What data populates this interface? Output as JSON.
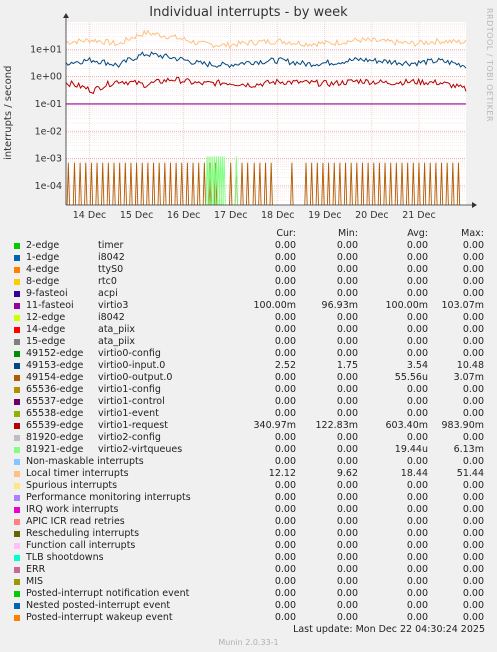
{
  "title": "Individual interrupts - by week",
  "side_label": "RRDTOOL / TOBI OETIKER",
  "ylabel": "interrupts / second",
  "legend_header": {
    "cur": "Cur:",
    "min": "Min:",
    "avg": "Avg:",
    "max": "Max:"
  },
  "legend": [
    {
      "a": "2-edge",
      "b": "timer",
      "color": "#00cc00",
      "cur": "0.00",
      "min": "0.00",
      "avg": "0.00",
      "max": "0.00"
    },
    {
      "a": "1-edge",
      "b": "i8042",
      "color": "#0066b3",
      "cur": "0.00",
      "min": "0.00",
      "avg": "0.00",
      "max": "0.00"
    },
    {
      "a": "4-edge",
      "b": "ttyS0",
      "color": "#ff8000",
      "cur": "0.00",
      "min": "0.00",
      "avg": "0.00",
      "max": "0.00"
    },
    {
      "a": "8-edge",
      "b": "rtc0",
      "color": "#ffcc00",
      "cur": "0.00",
      "min": "0.00",
      "avg": "0.00",
      "max": "0.00"
    },
    {
      "a": "9-fasteoi",
      "b": "acpi",
      "color": "#330099",
      "cur": "0.00",
      "min": "0.00",
      "avg": "0.00",
      "max": "0.00"
    },
    {
      "a": "11-fasteoi",
      "b": "virtio3",
      "color": "#990099",
      "cur": "100.00m",
      "min": "96.93m",
      "avg": "100.00m",
      "max": "103.07m"
    },
    {
      "a": "12-edge",
      "b": "i8042",
      "color": "#ccff00",
      "cur": "0.00",
      "min": "0.00",
      "avg": "0.00",
      "max": "0.00"
    },
    {
      "a": "14-edge",
      "b": "ata_piix",
      "color": "#ff0000",
      "cur": "0.00",
      "min": "0.00",
      "avg": "0.00",
      "max": "0.00"
    },
    {
      "a": "15-edge",
      "b": "ata_piix",
      "color": "#808080",
      "cur": "0.00",
      "min": "0.00",
      "avg": "0.00",
      "max": "0.00"
    },
    {
      "a": "49152-edge",
      "b": "virtio0-config",
      "color": "#008f00",
      "cur": "0.00",
      "min": "0.00",
      "avg": "0.00",
      "max": "0.00"
    },
    {
      "a": "49153-edge",
      "b": "virtio0-input.0",
      "color": "#00487d",
      "cur": "2.52",
      "min": "1.75",
      "avg": "3.54",
      "max": "10.48"
    },
    {
      "a": "49154-edge",
      "b": "virtio0-output.0",
      "color": "#b35a00",
      "cur": "0.00",
      "min": "0.00",
      "avg": "55.56u",
      "max": "3.07m"
    },
    {
      "a": "65536-edge",
      "b": "virtio1-config",
      "color": "#b38f00",
      "cur": "0.00",
      "min": "0.00",
      "avg": "0.00",
      "max": "0.00"
    },
    {
      "a": "65537-edge",
      "b": "virtio1-control",
      "color": "#6b006b",
      "cur": "0.00",
      "min": "0.00",
      "avg": "0.00",
      "max": "0.00"
    },
    {
      "a": "65538-edge",
      "b": "virtio1-event",
      "color": "#8fb300",
      "cur": "0.00",
      "min": "0.00",
      "avg": "0.00",
      "max": "0.00"
    },
    {
      "a": "65539-edge",
      "b": "virtio1-request",
      "color": "#b30000",
      "cur": "340.97m",
      "min": "122.83m",
      "avg": "603.40m",
      "max": "983.90m"
    },
    {
      "a": "81920-edge",
      "b": "virtio2-config",
      "color": "#bebebe",
      "cur": "0.00",
      "min": "0.00",
      "avg": "0.00",
      "max": "0.00"
    },
    {
      "a": "81921-edge",
      "b": "virtio2-virtqueues",
      "color": "#80ff80",
      "cur": "0.00",
      "min": "0.00",
      "avg": "19.44u",
      "max": "6.13m"
    },
    {
      "a": "Non-maskable interrupts",
      "b": "",
      "color": "#80c9ff",
      "cur": "0.00",
      "min": "0.00",
      "avg": "0.00",
      "max": "0.00"
    },
    {
      "a": "Local timer interrupts",
      "b": "",
      "color": "#ffc080",
      "cur": "12.12",
      "min": "9.62",
      "avg": "18.44",
      "max": "51.44"
    },
    {
      "a": "Spurious interrupts",
      "b": "",
      "color": "#ffe680",
      "cur": "0.00",
      "min": "0.00",
      "avg": "0.00",
      "max": "0.00"
    },
    {
      "a": "Performance monitoring interrupts",
      "b": "",
      "color": "#aa80ff",
      "cur": "0.00",
      "min": "0.00",
      "avg": "0.00",
      "max": "0.00"
    },
    {
      "a": "IRQ work interrupts",
      "b": "",
      "color": "#ee00cc",
      "cur": "0.00",
      "min": "0.00",
      "avg": "0.00",
      "max": "0.00"
    },
    {
      "a": "APIC ICR read retries",
      "b": "",
      "color": "#ff8080",
      "cur": "0.00",
      "min": "0.00",
      "avg": "0.00",
      "max": "0.00"
    },
    {
      "a": "Rescheduling interrupts",
      "b": "",
      "color": "#666600",
      "cur": "0.00",
      "min": "0.00",
      "avg": "0.00",
      "max": "0.00"
    },
    {
      "a": "Function call interrupts",
      "b": "",
      "color": "#ffbfff",
      "cur": "0.00",
      "min": "0.00",
      "avg": "0.00",
      "max": "0.00"
    },
    {
      "a": "TLB shootdowns",
      "b": "",
      "color": "#00ffcc",
      "cur": "0.00",
      "min": "0.00",
      "avg": "0.00",
      "max": "0.00"
    },
    {
      "a": "ERR",
      "b": "",
      "color": "#cc6699",
      "cur": "0.00",
      "min": "0.00",
      "avg": "0.00",
      "max": "0.00"
    },
    {
      "a": "MIS",
      "b": "",
      "color": "#999900",
      "cur": "0.00",
      "min": "0.00",
      "avg": "0.00",
      "max": "0.00"
    },
    {
      "a": "Posted-interrupt notification event",
      "b": "",
      "color": "#00cc00",
      "cur": "0.00",
      "min": "0.00",
      "avg": "0.00",
      "max": "0.00"
    },
    {
      "a": "Nested posted-interrupt event",
      "b": "",
      "color": "#0066b3",
      "cur": "0.00",
      "min": "0.00",
      "avg": "0.00",
      "max": "0.00"
    },
    {
      "a": "Posted-interrupt wakeup event",
      "b": "",
      "color": "#ff8000",
      "cur": "0.00",
      "min": "0.00",
      "avg": "0.00",
      "max": "0.00"
    }
  ],
  "last_update": "Last update:  Mon Dec 22 04:30:24 2025",
  "footer": "Munin 2.0.33-1",
  "chart_data": {
    "type": "line",
    "title": "Individual interrupts - by week",
    "ylabel": "interrupts / second",
    "yscale": "log",
    "ylim": [
      2e-05,
      100
    ],
    "yticks": [
      0.0001,
      0.001,
      0.01,
      0.1,
      1,
      10
    ],
    "ytick_labels": [
      "1e-04",
      "1e-03",
      "1e-02",
      "1e-01",
      "1e+00",
      "1e+01"
    ],
    "xticks": [
      "14 Dec",
      "15 Dec",
      "16 Dec",
      "17 Dec",
      "18 Dec",
      "19 Dec",
      "20 Dec",
      "21 Dec"
    ],
    "xlim": [
      0,
      8.5
    ],
    "grid": true,
    "series": [
      {
        "name": "Local timer interrupts",
        "color": "#ffc080",
        "kind": "noisy",
        "values": [
          18,
          22,
          15,
          40,
          28,
          16,
          14,
          18,
          20,
          16,
          17,
          22,
          19,
          16,
          20,
          18
        ]
      },
      {
        "name": "49153-edge virtio0-input.0",
        "color": "#00487d",
        "kind": "noisy",
        "values": [
          3.2,
          4.1,
          2.5,
          6.8,
          4.9,
          3.0,
          2.6,
          3.5,
          3.9,
          2.9,
          3.3,
          4.2,
          3.6,
          3.1,
          3.8,
          2.5
        ]
      },
      {
        "name": "65539-edge virtio1-request",
        "color": "#b30000",
        "kind": "noisy",
        "values": [
          0.6,
          0.3,
          0.7,
          0.5,
          0.8,
          0.55,
          0.6,
          0.5,
          0.65,
          0.6,
          0.55,
          0.7,
          0.6,
          0.65,
          0.6,
          0.34
        ]
      },
      {
        "name": "11-fasteoi virtio3",
        "color": "#990099",
        "kind": "flat",
        "values": [
          0.1,
          0.1
        ]
      },
      {
        "name": "49154-edge virtio0-output.0",
        "color": "#b35a00",
        "kind": "spikes",
        "value": 0.0007,
        "x": [
          0.05,
          0.18,
          0.3,
          0.42,
          0.54,
          0.66,
          0.78,
          0.9,
          1.02,
          1.14,
          1.26,
          1.38,
          1.5,
          1.62,
          1.74,
          1.86,
          1.98,
          2.1,
          2.22,
          2.34,
          2.46,
          2.58,
          2.7,
          2.82,
          2.94,
          3.06,
          3.18,
          3.5,
          3.62,
          3.74,
          3.86,
          4.0,
          4.12,
          4.24,
          4.36,
          4.8,
          5.1,
          5.22,
          5.34,
          5.46,
          5.58,
          5.7,
          5.82,
          5.94,
          6.06,
          6.18,
          6.3,
          6.42,
          6.54,
          6.66,
          6.78,
          6.9,
          7.02,
          7.14,
          7.26,
          7.38,
          7.5,
          7.62,
          7.74,
          7.86,
          7.98,
          8.1,
          8.22,
          8.34
        ]
      },
      {
        "name": "81921-edge virtio2-virtqueues",
        "color": "#80ff80",
        "kind": "spikes",
        "value": 0.0012,
        "x": [
          3.0,
          3.04,
          3.08,
          3.12,
          3.16,
          3.2,
          3.24,
          3.28,
          3.32,
          3.36,
          3.62
        ]
      }
    ]
  }
}
